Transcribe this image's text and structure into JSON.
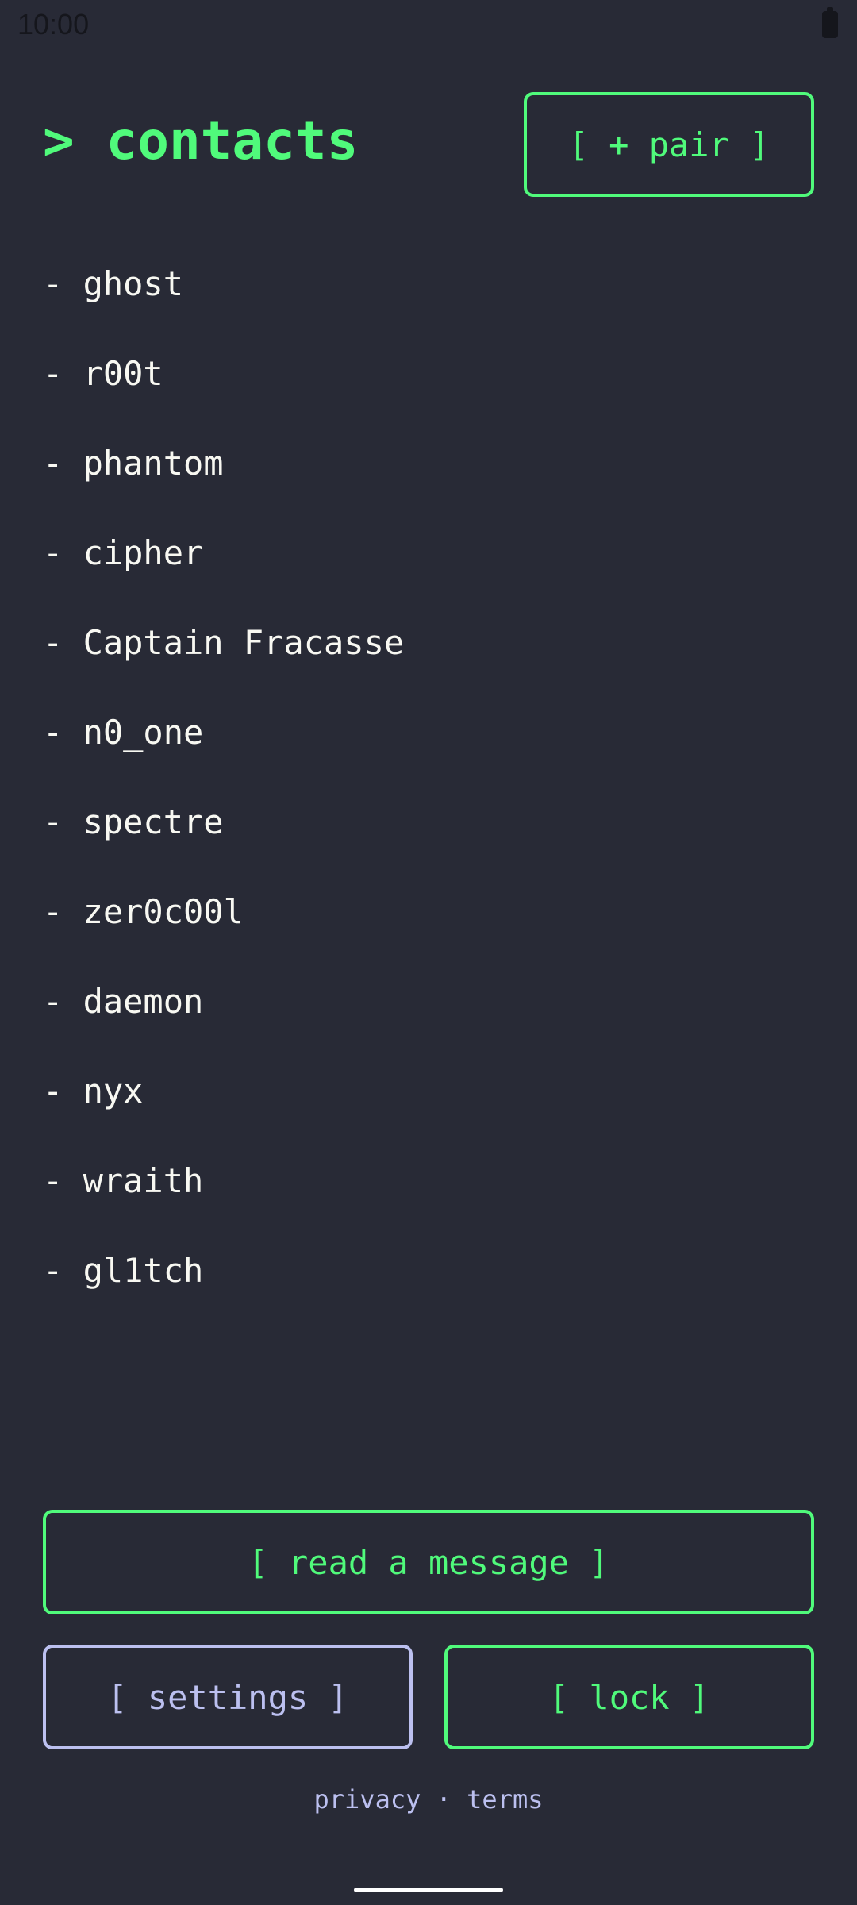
{
  "status_bar": {
    "time": "10:00",
    "battery_icon": "battery-icon"
  },
  "header": {
    "title": "> contacts",
    "pair_label": "[ + pair ]"
  },
  "contacts": [
    "- ghost",
    "- r00t",
    "- phantom",
    "- cipher",
    "- Captain Fracasse",
    "- n0_one",
    "- spectre",
    "- zer0c00l",
    "- daemon",
    "- nyx",
    "- wraith",
    "- gl1tch"
  ],
  "actions": {
    "read_label": "[ read a message ]",
    "settings_label": "[ settings ]",
    "lock_label": "[ lock ]"
  },
  "footer": {
    "privacy": "privacy",
    "separator": " · ",
    "terms": "terms"
  },
  "colors": {
    "background": "#282a36",
    "accent": "#50fa7b",
    "secondary": "#bcc0f0",
    "text": "#f8f8f2"
  }
}
